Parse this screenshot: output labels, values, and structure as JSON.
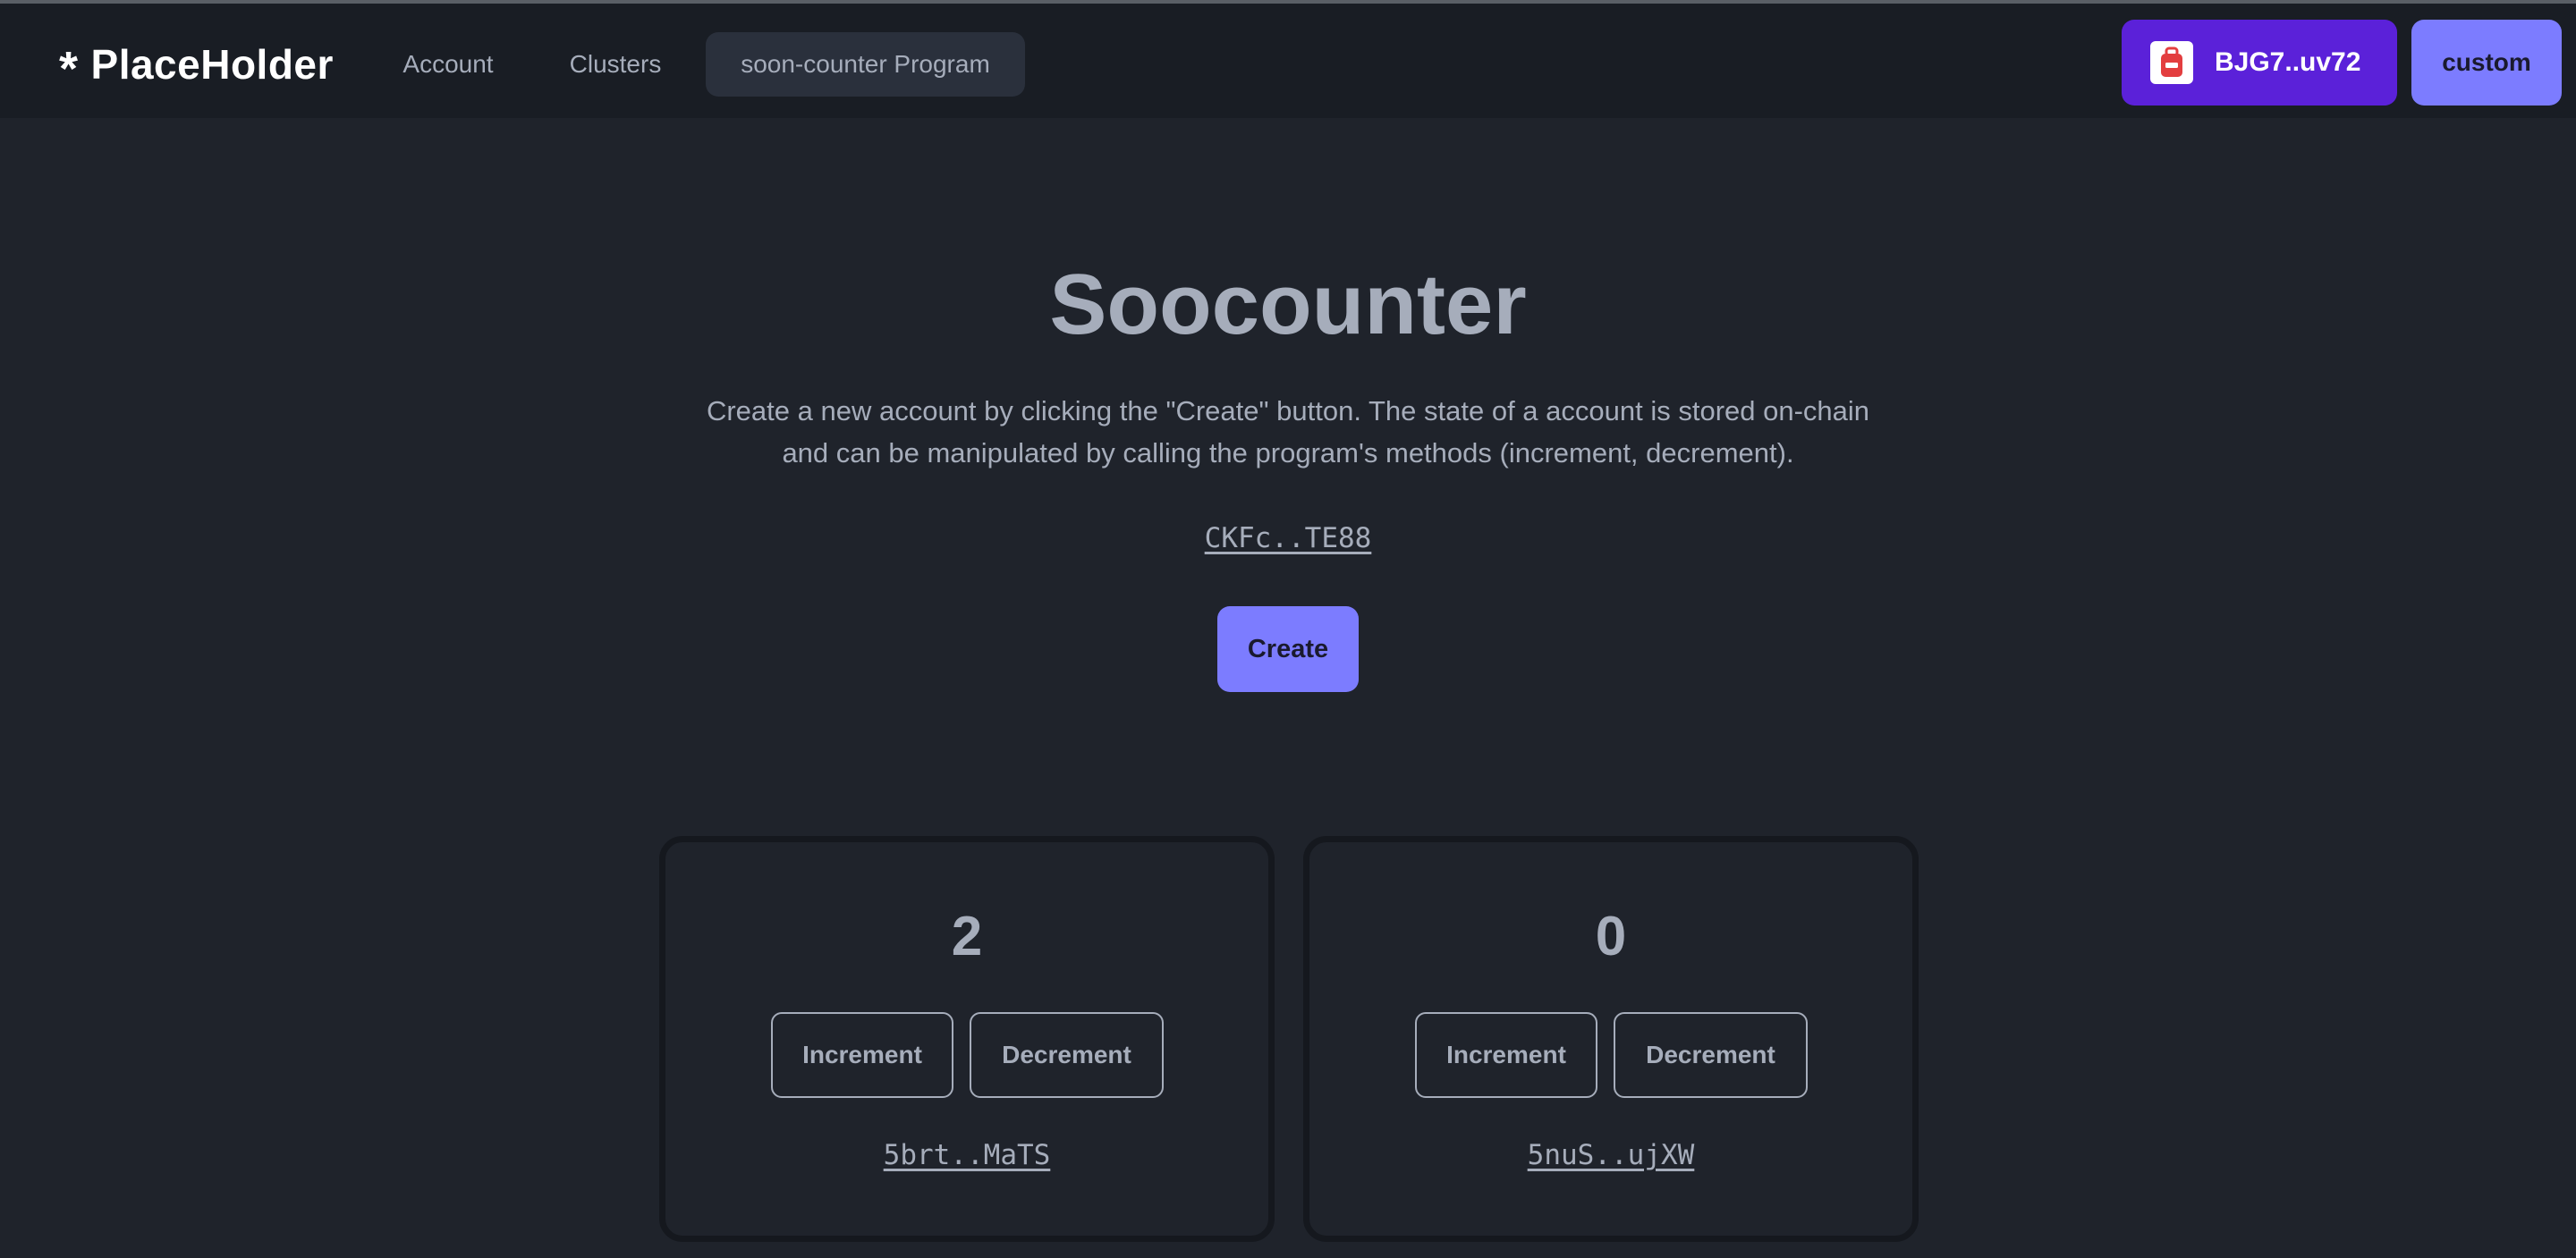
{
  "nav": {
    "logo_text": "PlaceHolder",
    "links": [
      {
        "label": "Account"
      },
      {
        "label": "Clusters"
      },
      {
        "label": "soon-counter Program"
      }
    ],
    "wallet_label": "BJG7..uv72",
    "cluster_label": "custom"
  },
  "hero": {
    "title": "Soocounter",
    "description": "Create a new account by clicking the \"Create\" button. The state of a account is stored on-chain and can be manipulated by calling the program's methods (increment, decrement).",
    "program_address": "CKFc..TE88",
    "create_label": "Create"
  },
  "cards": [
    {
      "count": "2",
      "increment_label": "Increment",
      "decrement_label": "Decrement",
      "address": "5brt..MaTS"
    },
    {
      "count": "0",
      "increment_label": "Increment",
      "decrement_label": "Decrement",
      "address": "5nuS..ujXW"
    }
  ],
  "colors": {
    "background": "#1f232b",
    "navbar": "#191d24",
    "wallet_button": "#5b21d9",
    "primary_button": "#7c7cff",
    "text": "#a6adbb"
  },
  "icons": {
    "logo": "asterisk-icon",
    "wallet": "backpack-wallet-icon"
  }
}
